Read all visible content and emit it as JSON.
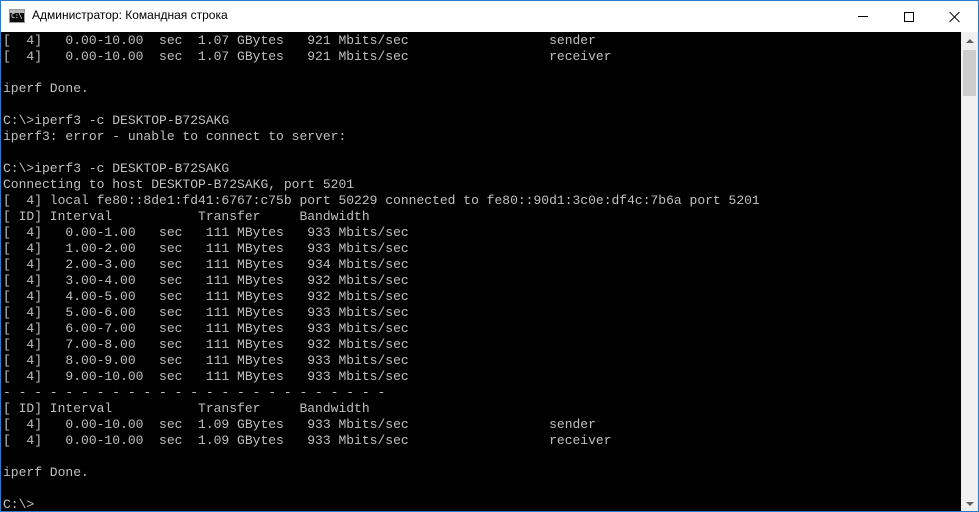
{
  "window": {
    "title": "Администратор: Командная строка",
    "icon": "cmd-icon"
  },
  "console": {
    "text_color": "#c0c0c0",
    "background": "#000000",
    "lines": [
      "[  4]   0.00-10.00  sec  1.07 GBytes   921 Mbits/sec                  sender",
      "[  4]   0.00-10.00  sec  1.07 GBytes   921 Mbits/sec                  receiver",
      "",
      "iperf Done.",
      "",
      "C:\\>iperf3 -c DESKTOP-B72SAKG",
      "iperf3: error - unable to connect to server:",
      "",
      "C:\\>iperf3 -c DESKTOP-B72SAKG",
      "Connecting to host DESKTOP-B72SAKG, port 5201",
      "[  4] local fe80::8de1:fd41:6767:c75b port 50229 connected to fe80::90d1:3c0e:df4c:7b6a port 5201",
      "[ ID] Interval           Transfer     Bandwidth",
      "[  4]   0.00-1.00   sec   111 MBytes   933 Mbits/sec",
      "[  4]   1.00-2.00   sec   111 MBytes   933 Mbits/sec",
      "[  4]   2.00-3.00   sec   111 MBytes   934 Mbits/sec",
      "[  4]   3.00-4.00   sec   111 MBytes   932 Mbits/sec",
      "[  4]   4.00-5.00   sec   111 MBytes   932 Mbits/sec",
      "[  4]   5.00-6.00   sec   111 MBytes   933 Mbits/sec",
      "[  4]   6.00-7.00   sec   111 MBytes   933 Mbits/sec",
      "[  4]   7.00-8.00   sec   111 MBytes   932 Mbits/sec",
      "[  4]   8.00-9.00   sec   111 MBytes   933 Mbits/sec",
      "[  4]   9.00-10.00  sec   111 MBytes   933 Mbits/sec",
      "- - - - - - - - - - - - - - - - - - - - - - - - -",
      "[ ID] Interval           Transfer     Bandwidth",
      "[  4]   0.00-10.00  sec  1.09 GBytes   933 Mbits/sec                  sender",
      "[  4]   0.00-10.00  sec  1.09 GBytes   933 Mbits/sec                  receiver",
      "",
      "iperf Done.",
      "",
      "C:\\>"
    ]
  },
  "controls": {
    "minimize_icon": "minimize-icon",
    "maximize_icon": "maximize-icon",
    "close_icon": "close-icon",
    "close_hover_color": "#e81123"
  }
}
